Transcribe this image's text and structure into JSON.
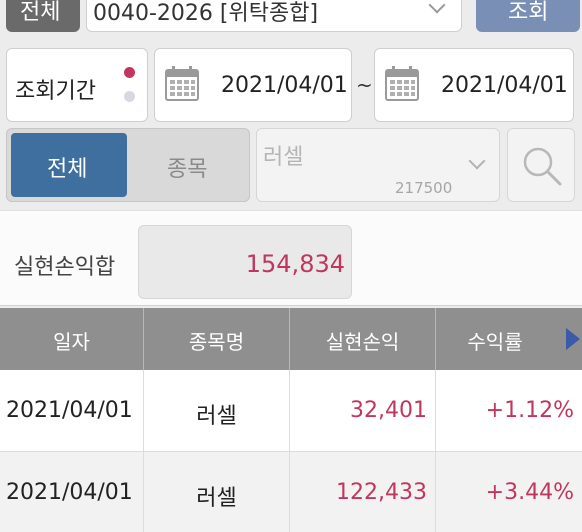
{
  "top_bar": {
    "left_button_label": "전체",
    "account_text": "0040-2026 [위탁종합]",
    "right_button_label": "조회"
  },
  "period": {
    "label": "조회기간",
    "start_date": "2021/04/01",
    "separator": "~",
    "end_date": "2021/04/01"
  },
  "filter": {
    "all_label": "전체",
    "stock_label": "종목",
    "stock_name": "러셀",
    "stock_code": "217500"
  },
  "summary": {
    "label": "실현손익합",
    "value": "154,834"
  },
  "table": {
    "headers": [
      "일자",
      "종목명",
      "실현손익",
      "수익률"
    ],
    "rows": [
      [
        "2021/04/01",
        "러셀",
        "32,401",
        "+1.12%"
      ],
      [
        "2021/04/01",
        "러셀",
        "122,433",
        "+3.44%"
      ]
    ]
  },
  "colors": {
    "accent_blue": "#3f6f9f",
    "positive_red": "#c0365f",
    "header_gray": "#8f8f8f"
  }
}
